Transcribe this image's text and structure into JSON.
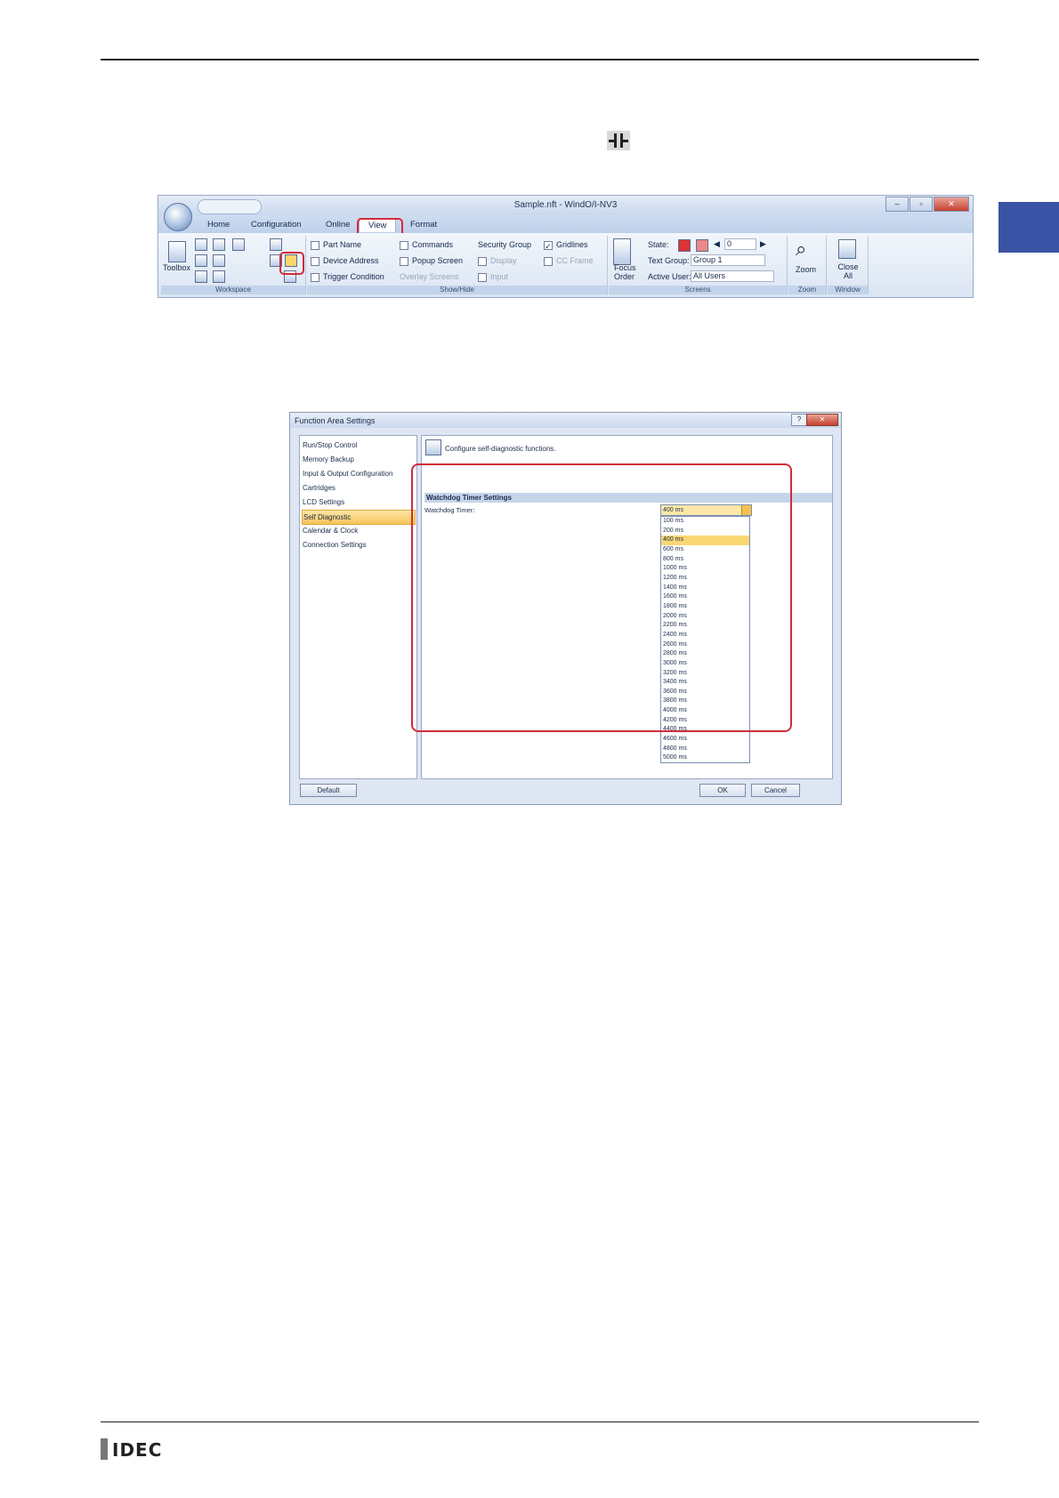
{
  "ribbon": {
    "window_title": "Sample.nft - WindO/I-NV3",
    "tabs": [
      "Home",
      "Configuration",
      "Online",
      "View",
      "Format"
    ],
    "workspace": {
      "toolbox_label": "Toolbox",
      "group_label": "Workspace"
    },
    "show_hide": {
      "part_name": "Part Name",
      "device_address": "Device Address",
      "trigger_condition": "Trigger Condition",
      "commands": "Commands",
      "popup_screen": "Popup Screen",
      "overlay_screens": "Overlay Screens",
      "security_group": "Security Group",
      "display": "Display",
      "input": "Input",
      "gridlines": "Gridlines",
      "cc_frame": "CC Frame",
      "group_label": "Show/Hide"
    },
    "screens": {
      "focus_order": "Focus Order",
      "state_label": "State:",
      "state_value": "0",
      "text_group_label": "Text Group:",
      "text_group_value": "Group 1",
      "active_user_label": "Active User:",
      "active_user_value": "All Users",
      "group_label": "Screens"
    },
    "zoom": {
      "label": "Zoom",
      "group_label": "Zoom"
    },
    "window": {
      "label": "Close All",
      "group_label": "Window"
    }
  },
  "dialog": {
    "title": "Function Area Settings",
    "nav_items": [
      "Run/Stop Control",
      "Memory Backup",
      "Input & Output Configuration",
      "Cartridges",
      "LCD Settings",
      "Self Diagnostic",
      "Calendar & Clock",
      "Connection Settings"
    ],
    "selected_nav": "Self Diagnostic",
    "description": "Configure self-diagnostic functions.",
    "section_header": "Watchdog Timer Settings",
    "field_label": "Watchdog Timer:",
    "selected_value": "400 ms",
    "options": [
      "100 ms",
      "200 ms",
      "400 ms",
      "600 ms",
      "800 ms",
      "1000 ms",
      "1200 ms",
      "1400 ms",
      "1600 ms",
      "1800 ms",
      "2000 ms",
      "2200 ms",
      "2400 ms",
      "2600 ms",
      "2800 ms",
      "3000 ms",
      "3200 ms",
      "3400 ms",
      "3600 ms",
      "3800 ms",
      "4000 ms",
      "4200 ms",
      "4400 ms",
      "4600 ms",
      "4800 ms",
      "5000 ms"
    ],
    "buttons": {
      "default": "Default",
      "ok": "OK",
      "cancel": "Cancel"
    }
  },
  "footer": {
    "logo_text": "IDEC"
  },
  "colors": {
    "highlight_red": "#d32b3a",
    "tab_blue": "#3a53a4",
    "selection_orange": "#f6c45a"
  }
}
